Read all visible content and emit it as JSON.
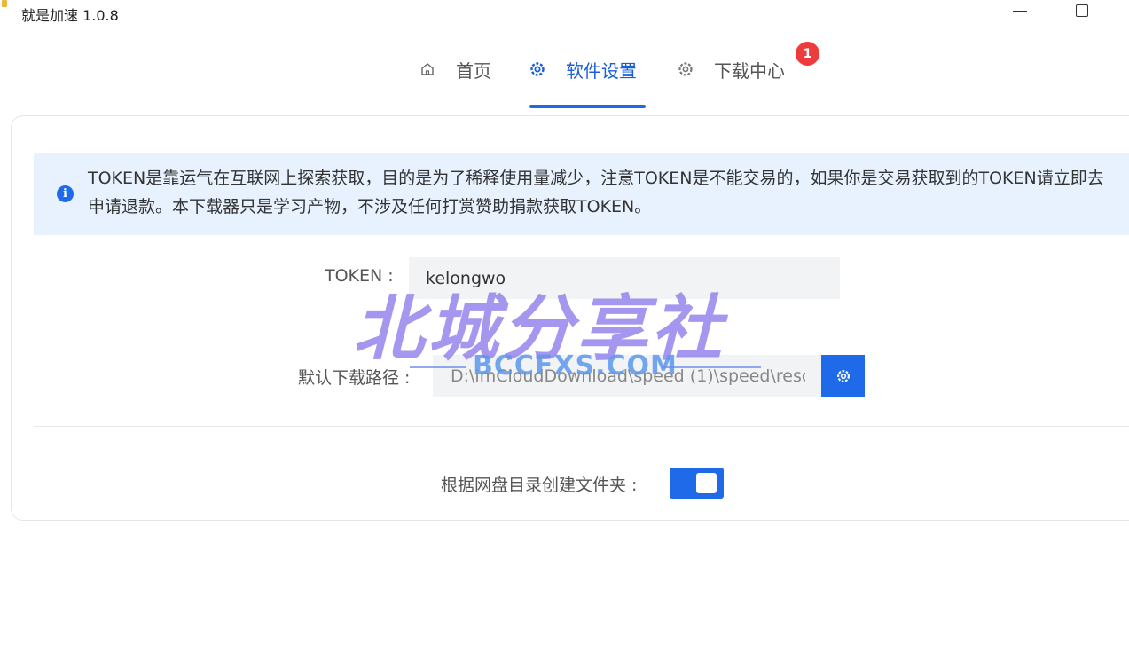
{
  "window": {
    "title": "就是加速 1.0.8",
    "icons": {
      "app": "app-icon",
      "minimize": "minimize-icon",
      "maximize": "maximize-icon"
    }
  },
  "tabs": [
    {
      "label": "首页",
      "icon": "home-icon",
      "active": false
    },
    {
      "label": "软件设置",
      "icon": "gear-icon",
      "active": true
    },
    {
      "label": "下载中心",
      "icon": "gear-icon",
      "active": false,
      "badge": "1"
    }
  ],
  "notice": {
    "icon": "info-icon",
    "text": "TOKEN是靠运气在互联网上探索获取，目的是为了稀释使用量减少，注意TOKEN是不能交易的，如果你是交易获取到的TOKEN请立即去申请退款。本下载器只是学习产物，不涉及任何打赏赞助捐款获取TOKEN。"
  },
  "settings": {
    "token": {
      "label": "TOKEN :",
      "value": "kelongwo"
    },
    "download_path": {
      "label": "默认下载路径 :",
      "value": "D:\\imCloudDownload\\speed (1)\\speed\\resc",
      "button_icon": "gear-icon"
    },
    "create_folder": {
      "label": "根据网盘目录创建文件夹 :",
      "enabled": true
    }
  },
  "watermark": {
    "main": "北城分享社",
    "sub": "BCCFXS.COM"
  },
  "colors": {
    "accent": "#1e6ae8",
    "badge": "#ee3b3b",
    "notice_bg": "#e8f2ff"
  }
}
